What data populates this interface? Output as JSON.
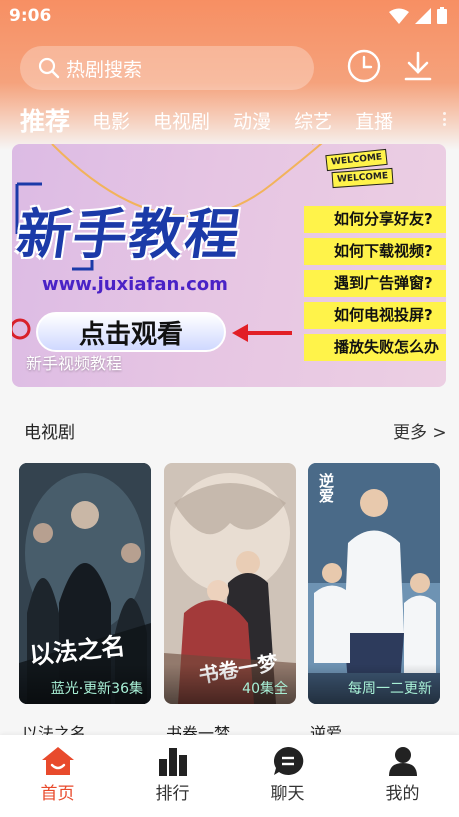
{
  "status": {
    "time": "9:06"
  },
  "search": {
    "placeholder": "热剧搜索"
  },
  "tabs": [
    "推荐",
    "电影",
    "电视剧",
    "动漫",
    "综艺",
    "直播"
  ],
  "banner": {
    "title": "新手教程",
    "url": "www.juxiafan.com",
    "button": "点击观看",
    "caption": "新手视频教程",
    "welcome1": "WELCOME",
    "welcome2": "WELCOME",
    "list": [
      "如何分享好友?",
      "如何下载视频?",
      "遇到广告弹窗?",
      "如何电视投屏?",
      "播放失败怎么办"
    ]
  },
  "section": {
    "title": "电视剧",
    "more": "更多 >"
  },
  "cards": [
    {
      "title": "以法之名",
      "badge": "蓝光·更新36集",
      "poster_text": "以法之名"
    },
    {
      "title": "书卷一梦",
      "badge": "40集全",
      "poster_text": "书卷一梦"
    },
    {
      "title": "逆爱",
      "badge": "每周一二更新",
      "poster_text": "逆爱"
    }
  ],
  "nav": [
    {
      "label": "首页",
      "icon": "home-icon",
      "active": true
    },
    {
      "label": "排行",
      "icon": "ranking-icon",
      "active": false
    },
    {
      "label": "聊天",
      "icon": "chat-icon",
      "active": false
    },
    {
      "label": "我的",
      "icon": "profile-icon",
      "active": false
    }
  ],
  "colors": {
    "accent": "#e84a2c",
    "header": "#f78f63",
    "badge": "#a8f0d6"
  }
}
